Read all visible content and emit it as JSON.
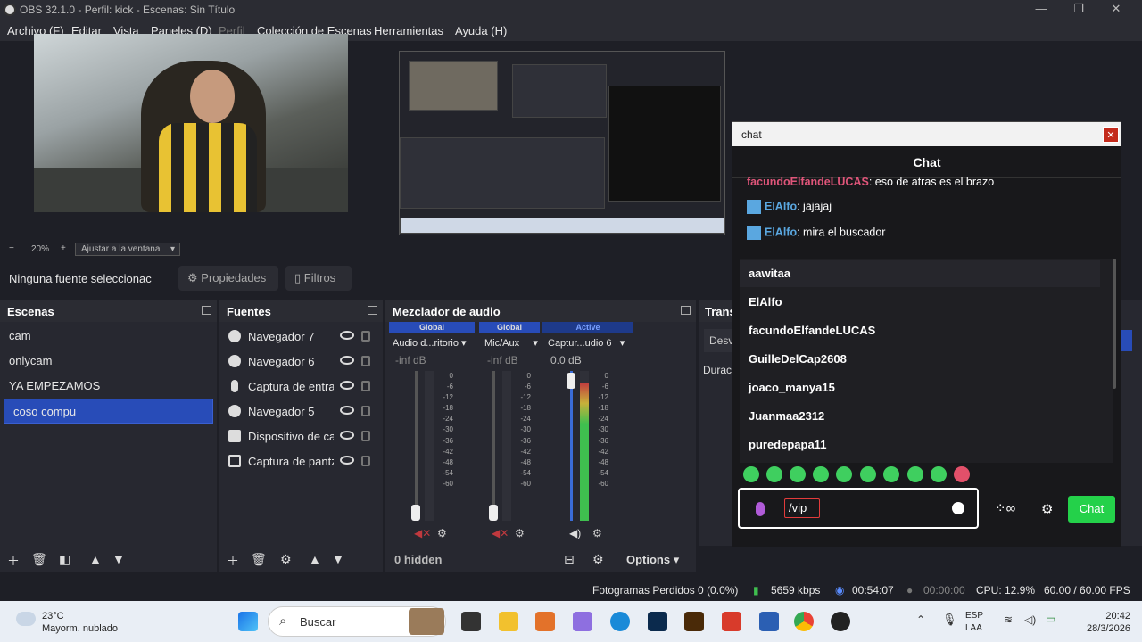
{
  "window": {
    "title": "OBS 32.1.0 - Perfil: kick - Escenas: Sin Título"
  },
  "menu": [
    "Archivo (F)",
    "Editar",
    "Vista",
    "Paneles (D)",
    "Perfil",
    "Colección de Escenas",
    "Herramientas",
    "Ayuda (H)"
  ],
  "zoom": {
    "minus": "−",
    "level": "20%",
    "plus": "+",
    "fit": "Ajustar a la ventana"
  },
  "sourcebar": {
    "no_selection": "Ninguna fuente seleccionac",
    "properties": "Propiedades",
    "filters": "Filtros"
  },
  "scenes": {
    "title": "Escenas",
    "items": [
      "cam",
      "onlycam",
      "YA EMPEZAMOS",
      "coso compu"
    ],
    "selected": "coso compu"
  },
  "sources": {
    "title": "Fuentes",
    "items": [
      "Navegador 7",
      "Navegador 6",
      "Captura de entra",
      "Navegador 5",
      "Dispositivo de ca",
      "Captura de pantz"
    ]
  },
  "mixer": {
    "title": "Mezclador de audio",
    "channels": [
      {
        "tag": "Global",
        "name": "Audio d...ritorio",
        "db": "-inf dB",
        "level": 0.0
      },
      {
        "tag": "Global",
        "name": "Mic/Aux",
        "db": "-inf dB",
        "level": 0.0
      },
      {
        "tag": "Active",
        "name": "Captur...udio 6",
        "db": "0.0 dB",
        "level": 0.92
      }
    ],
    "scale": [
      "0",
      "-6",
      "-12",
      "-18",
      "-24",
      "-30",
      "-36",
      "-42",
      "-48",
      "-54",
      "-60"
    ],
    "hidden": "0 hidden",
    "options": "Options"
  },
  "transitions": {
    "title": "Trans",
    "item": "Desv",
    "duration": "Durac"
  },
  "chat": {
    "window_title": "chat",
    "header": "Chat",
    "messages": [
      {
        "user": "facundoElfandeLUCAS",
        "text": ": eso de atras es el brazo",
        "color": "#e0557a"
      },
      {
        "user": "ElAlfo",
        "text": ": jajajaj",
        "color": "#5aa7e0"
      },
      {
        "user": "ElAlfo",
        "text": ": mira el buscador",
        "color": "#5aa7e0"
      }
    ],
    "autocomplete": [
      "aawitaa",
      "ElAlfo",
      "facundoElfandeLUCAS",
      "GuilleDelCap2608",
      "joaco_manya15",
      "Juanmaa2312",
      "puredepapa11"
    ],
    "input_value": "/vip",
    "send": "Chat"
  },
  "status": {
    "dropped": "Fotogramas Perdidos 0 (0.0%)",
    "kbps": "5659 kbps",
    "live_time": "00:54:07",
    "rec_time": "00:00:00",
    "cpu": "CPU: 12.9%",
    "fps": "60.00 / 60.00 FPS"
  },
  "taskbar": {
    "temp": "23°C",
    "weather": "Mayorm. nublado",
    "search": "Buscar",
    "lang1": "ESP",
    "lang2": "LAA",
    "time": "20:42",
    "date": "28/3/2026"
  }
}
